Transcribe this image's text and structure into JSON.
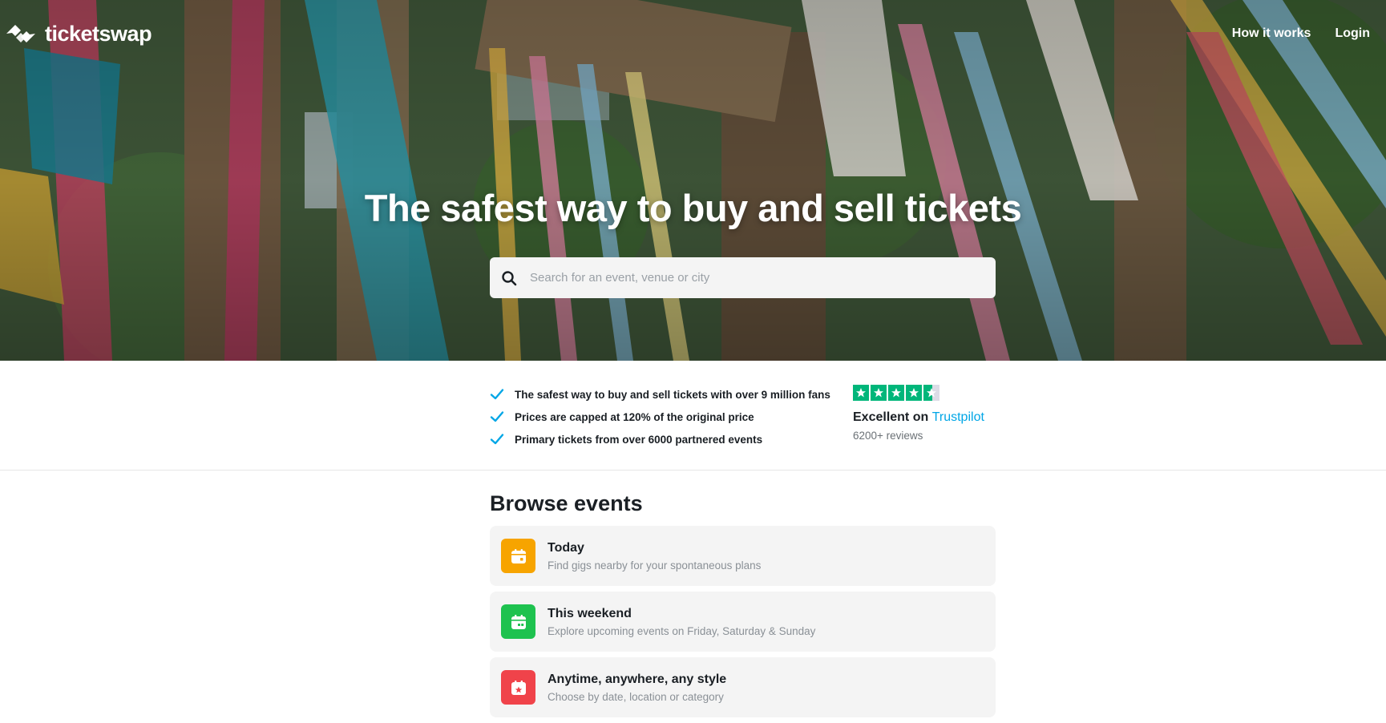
{
  "header": {
    "brand": "ticketswap",
    "nav": [
      {
        "label": "How it works"
      },
      {
        "label": "Login"
      }
    ]
  },
  "hero": {
    "title": "The safest way to buy and sell tickets",
    "search_placeholder": "Search for an event, venue or city"
  },
  "usps": [
    "The safest way to buy and sell tickets with over 9 million fans",
    "Prices are capped at 120% of the original price",
    "Primary tickets from over 6000 partnered events"
  ],
  "trustpilot": {
    "rating_stars": 4.5,
    "prefix": "Excellent on",
    "link": "Trustpilot",
    "reviews": "6200+ reviews",
    "color": "#00b67a"
  },
  "browse": {
    "heading": "Browse events",
    "categories": [
      {
        "title": "Today",
        "description": "Find gigs nearby for your spontaneous plans",
        "icon": "calendar-icon",
        "color": "#f7a400"
      },
      {
        "title": "This weekend",
        "description": "Explore upcoming events on Friday, Saturday & Sunday",
        "icon": "calendar-weekend-icon",
        "color": "#1ec24f"
      },
      {
        "title": "Anytime, anywhere, any style",
        "description": "Choose by date, location or category",
        "icon": "calendar-star-icon",
        "color": "#f0434a"
      }
    ]
  },
  "colors": {
    "accent": "#00a6e6",
    "check": "#00a6e6"
  }
}
